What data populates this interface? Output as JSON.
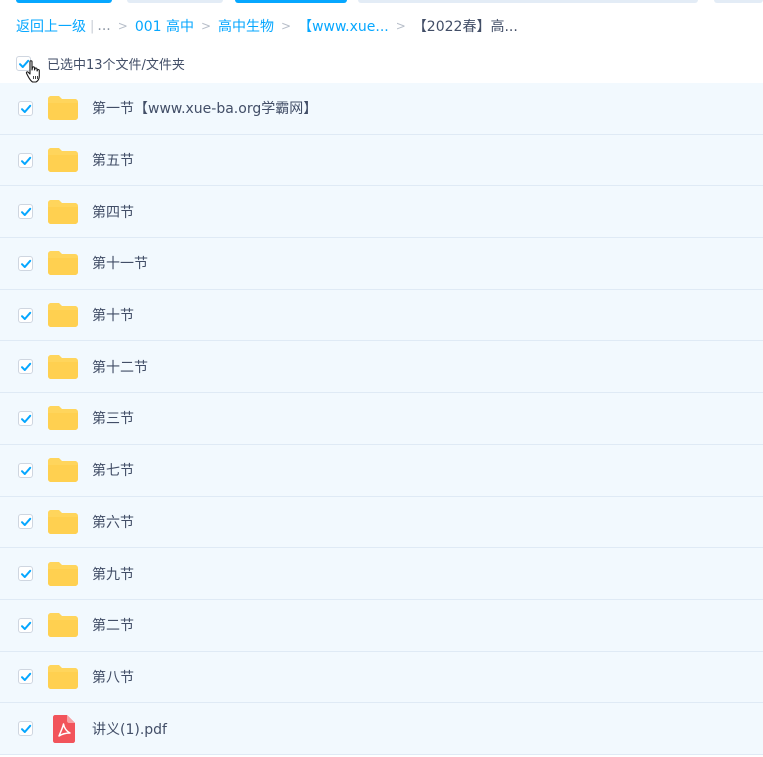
{
  "breadcrumb": {
    "back": "返回上一级",
    "ellipsis": "...",
    "items": [
      "001 高中",
      "高中生物",
      "【www.xue...",
      "【2022春】高..."
    ]
  },
  "selection": {
    "label": "已选中13个文件/文件夹"
  },
  "files": [
    {
      "name": "第一节【www.xue-ba.org学霸网】",
      "type": "folder-icon"
    },
    {
      "name": "第五节",
      "type": "folder-icon"
    },
    {
      "name": "第四节",
      "type": "folder-icon"
    },
    {
      "name": "第十一节",
      "type": "folder-icon"
    },
    {
      "name": "第十节",
      "type": "folder-icon"
    },
    {
      "name": "第十二节",
      "type": "folder-icon"
    },
    {
      "name": "第三节",
      "type": "folder-icon"
    },
    {
      "name": "第七节",
      "type": "folder-icon"
    },
    {
      "name": "第六节",
      "type": "folder-icon"
    },
    {
      "name": "第九节",
      "type": "folder-icon"
    },
    {
      "name": "第二节",
      "type": "folder-icon"
    },
    {
      "name": "第八节",
      "type": "folder-icon"
    },
    {
      "name": "讲义(1).pdf",
      "type": "pdf-icon"
    }
  ],
  "colors": {
    "accent": "#06a7ff",
    "row_bg": "#f2f9fe",
    "folder": "#ffd55c",
    "pdf": "#f2545b"
  }
}
